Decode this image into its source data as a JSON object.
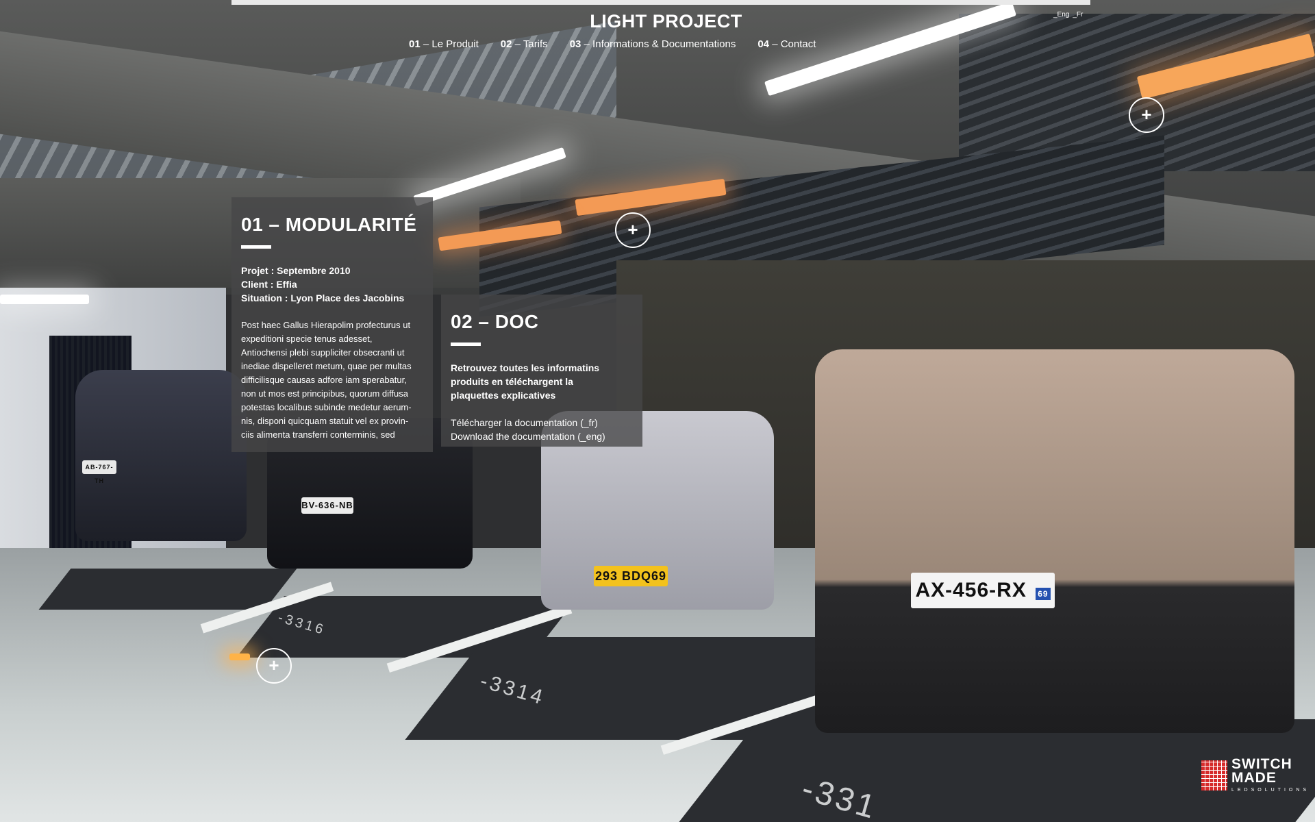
{
  "header": {
    "brand": "LIGHT PROJECT",
    "nav": [
      {
        "num": "01",
        "label": "– Le Produit"
      },
      {
        "num": "02",
        "label": "– Tarifs"
      },
      {
        "num": "03",
        "label": "– Informations & Documentations"
      },
      {
        "num": "04",
        "label": "– Contact"
      }
    ],
    "lang": [
      "_Eng",
      "_Fr"
    ]
  },
  "panel_modularite": {
    "title": "01 – MODULARITÉ",
    "meta": [
      "Projet : Septembre 2010",
      "Client : Effia",
      "Situation : Lyon Place des Jacobins"
    ],
    "body": [
      "Post haec Gallus Hierapolim profecturus ut",
      "expeditioni specie tenus adesset,",
      "Antiochensi plebi suppliciter obsecranti ut",
      "inediae dispelleret metum, quae per multas",
      "difficilisque causas adfore iam sperabatur,",
      "non ut mos est principibus, quorum diffusa",
      "potestas localibus subinde medetur aerum-",
      "nis, disponi quicquam statuit vel ex provin-",
      "ciis alimenta transferri conterminis, sed"
    ]
  },
  "panel_doc": {
    "title": "02 – DOC",
    "intro": [
      "Retrouvez toutes les informatins",
      "produits en téléchargent la",
      "plaquettes explicatives"
    ],
    "links": [
      "Télécharger la documentation (_fr)",
      "Download the documentation (_eng)"
    ]
  },
  "hotspots": [
    "+",
    "+",
    "+"
  ],
  "scene": {
    "plates": [
      "BV-636-NB",
      "293 BDQ69",
      "AX-456-RX",
      "AB-767-TH"
    ],
    "plate_badge": "69",
    "bay_numbers": [
      "-3314",
      "-3316",
      "-331"
    ]
  },
  "logo": {
    "line1": "SWITCH",
    "line2": "MADE",
    "sub": "LEDSOLUTIONS"
  },
  "colors": {
    "panel": "#464648",
    "accent_red": "#d62b2b",
    "light": "#ffffff"
  }
}
